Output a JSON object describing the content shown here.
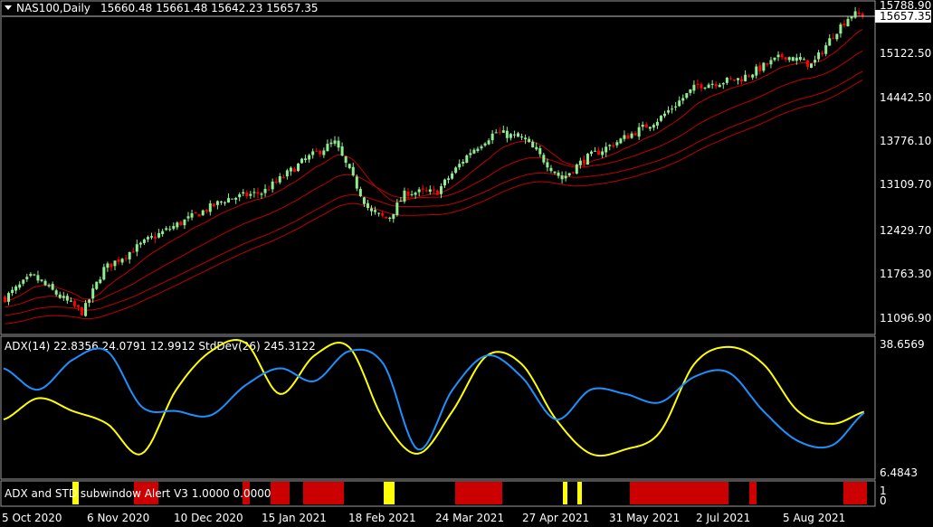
{
  "main_window": {
    "title": "NAS100,Daily",
    "ohlc": "15660.48 15661.48 15642.23 15657.35",
    "price_axis": [
      "15788.90",
      "15122.50",
      "14442.50",
      "13776.10",
      "13109.70",
      "12429.70",
      "11763.30",
      "11096.90"
    ],
    "current_price": "15657.35",
    "colors": {
      "bull": "#90ee90",
      "bear": "#ff0000",
      "yellow": "#ffff00",
      "ma": "#c00000",
      "grid": "#c0c0c0"
    }
  },
  "adx_window": {
    "title": "ADX(14) 22.8356 24.0791 12.9912 StdDev(26) 245.3122",
    "axis_top": "38.6569",
    "axis_bottom": "6.4843",
    "colors": {
      "adx": "#ffff00",
      "di": "#1e90ff"
    }
  },
  "alert_window": {
    "title": "ADX and STD subwindow Alert V3 1.0000 0.0000",
    "axis_top": "1",
    "axis_bottom": "0",
    "colors": {
      "red": "#cc0000",
      "yellow": "#ffff00"
    }
  },
  "time_axis": [
    "5 Oct 2020",
    "6 Nov 2020",
    "10 Dec 2020",
    "15 Jan 2021",
    "18 Feb 2021",
    "24 Mar 2021",
    "27 Apr 2021",
    "31 May 2021",
    "2 Jul 2021",
    "5 Aug 2021"
  ],
  "chart_data": [
    {
      "type": "candlestick",
      "symbol": "NAS100",
      "timeframe": "Daily",
      "ylim": [
        10900,
        15850
      ],
      "close_path": [
        [
          "5 Oct 2020",
          11400
        ],
        [
          "16 Oct 2020",
          11750
        ],
        [
          "26 Oct 2020",
          11450
        ],
        [
          "4 Nov 2020",
          11200
        ],
        [
          "12 Nov 2020",
          11850
        ],
        [
          "30 Nov 2020",
          12300
        ],
        [
          "10 Dec 2020",
          12500
        ],
        [
          "31 Dec 2020",
          12900
        ],
        [
          "15 Jan 2021",
          13000
        ],
        [
          "1 Feb 2021",
          13500
        ],
        [
          "12 Feb 2021",
          13750
        ],
        [
          "26 Feb 2021",
          12700
        ],
        [
          "5 Mar 2021",
          12600
        ],
        [
          "12 Mar 2021",
          13000
        ],
        [
          "24 Mar 2021",
          13000
        ],
        [
          "6 Apr 2021",
          13600
        ],
        [
          "16 Apr 2021",
          13900
        ],
        [
          "27 Apr 2021",
          13800
        ],
        [
          "12 May 2021",
          13200
        ],
        [
          "21 May 2021",
          13500
        ],
        [
          "31 May 2021",
          13700
        ],
        [
          "18 Jun 2021",
          14100
        ],
        [
          "2 Jul 2021",
          14600
        ],
        [
          "19 Jul 2021",
          14700
        ],
        [
          "5 Aug 2021",
          15050
        ],
        [
          "16 Aug 2021",
          14900
        ],
        [
          "25 Aug 2021",
          15400
        ],
        [
          "31 Aug 2021",
          15657.35
        ]
      ]
    },
    {
      "type": "line",
      "name": "ADX(14)",
      "ylim": [
        6.4843,
        38.6569
      ],
      "series": [
        {
          "name": "ADX",
          "values": [
            20,
            25,
            22,
            19,
            12,
            27,
            36,
            38,
            26,
            35,
            37,
            20,
            12,
            22,
            35,
            33,
            20,
            12,
            13,
            17,
            33,
            37,
            33,
            22,
            19,
            22
          ]
        },
        {
          "name": "StdDev(26)",
          "values": [
            32,
            27,
            34,
            36,
            23,
            22,
            21,
            28,
            32,
            29,
            36,
            33,
            13,
            27,
            35,
            30,
            20,
            27,
            26,
            24,
            30,
            31,
            22,
            15,
            14,
            22
          ]
        }
      ]
    },
    {
      "type": "bar",
      "name": "ADX and STD subwindow Alert V3",
      "ylim": [
        0,
        1
      ]
    }
  ]
}
